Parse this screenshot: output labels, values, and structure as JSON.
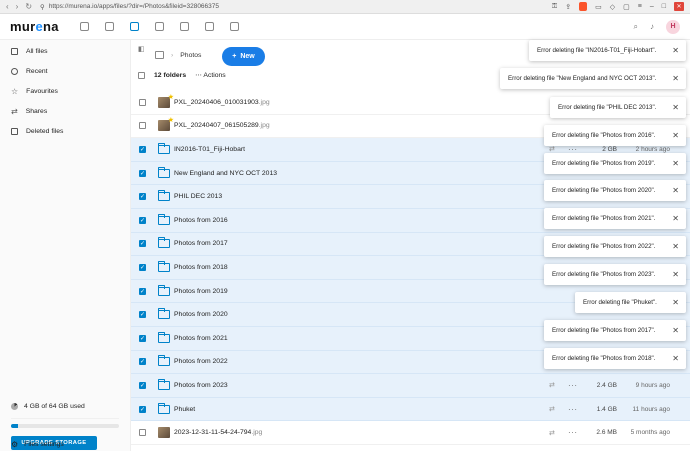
{
  "browser": {
    "url": "https://murena.io/apps/files/?dir=/Photos&fileid=328066375"
  },
  "app": {
    "logo_prefix": "mur",
    "logo_accent": "e",
    "logo_suffix": "na",
    "avatar_initial": "H",
    "brand_color": "#0082c9"
  },
  "sidebar": {
    "items": [
      {
        "label": "All files",
        "icon": "folder-icon"
      },
      {
        "label": "Recent",
        "icon": "clock-icon"
      },
      {
        "label": "Favourites",
        "icon": "star-icon"
      },
      {
        "label": "Shares",
        "icon": "share-icon"
      },
      {
        "label": "Deleted files",
        "icon": "trash-icon"
      }
    ],
    "storage_text": "4 GB of 64 GB used",
    "storage_fraction": 0.0625,
    "upgrade_label": "UPGRADE STORAGE",
    "settings_label": "Files settings"
  },
  "main": {
    "breadcrumb": "Photos",
    "new_label": "New",
    "count_label": "12 folders",
    "actions_label": "Actions",
    "rows": [
      {
        "name": "PXL_20240406_010031903",
        "ext": ".jpg",
        "type": "image",
        "selected": false,
        "size": "",
        "modified": ""
      },
      {
        "name": "PXL_20240407_061505289",
        "ext": ".jpg",
        "type": "image",
        "selected": false,
        "size": "",
        "modified": ""
      },
      {
        "name": "IN2016-T01_Fiji-Hobart",
        "ext": "",
        "type": "folder",
        "selected": true,
        "size": "2 GB",
        "modified": "2 hours ago"
      },
      {
        "name": "New England and NYC OCT 2013",
        "ext": "",
        "type": "folder",
        "selected": true,
        "size": "",
        "modified": ""
      },
      {
        "name": "PHIL DEC 2013",
        "ext": "",
        "type": "folder",
        "selected": true,
        "size": "",
        "modified": ""
      },
      {
        "name": "Photos from 2016",
        "ext": "",
        "type": "folder",
        "selected": true,
        "size": "",
        "modified": ""
      },
      {
        "name": "Photos from 2017",
        "ext": "",
        "type": "folder",
        "selected": true,
        "size": "",
        "modified": ""
      },
      {
        "name": "Photos from 2018",
        "ext": "",
        "type": "folder",
        "selected": true,
        "size": "",
        "modified": ""
      },
      {
        "name": "Photos from 2019",
        "ext": "",
        "type": "folder",
        "selected": true,
        "size": "",
        "modified": ""
      },
      {
        "name": "Photos from 2020",
        "ext": "",
        "type": "folder",
        "selected": true,
        "size": "",
        "modified": ""
      },
      {
        "name": "Photos from 2021",
        "ext": "",
        "type": "folder",
        "selected": true,
        "size": "",
        "modified": ""
      },
      {
        "name": "Photos from 2022",
        "ext": "",
        "type": "folder",
        "selected": true,
        "size": "",
        "modified": ""
      },
      {
        "name": "Photos from 2023",
        "ext": "",
        "type": "folder",
        "selected": true,
        "size": "2.4 GB",
        "modified": "9 hours ago"
      },
      {
        "name": "Phuket",
        "ext": "",
        "type": "folder",
        "selected": true,
        "size": "1.4 GB",
        "modified": "11 hours ago"
      },
      {
        "name": "2023-12-31-11-54-24-794",
        "ext": ".jpg",
        "type": "image",
        "selected": false,
        "size": "2.6 MB",
        "modified": "5 months ago"
      }
    ]
  },
  "toasts": [
    "Error deleting file \"IN2016-T01_Fiji-Hobart\".",
    "Error deleting file \"New England and NYC OCT 2013\".",
    "Error deleting file \"PHIL DEC 2013\".",
    "Error deleting file \"Photos from 2016\".",
    "Error deleting file \"Photos from 2019\".",
    "Error deleting file \"Photos from 2020\".",
    "Error deleting file \"Photos from 2021\".",
    "Error deleting file \"Photos from 2022\".",
    "Error deleting file \"Photos from 2023\".",
    "Error deleting file \"Phuket\".",
    "Error deleting file \"Photos from 2017\".",
    "Error deleting file \"Photos from 2018\"."
  ]
}
